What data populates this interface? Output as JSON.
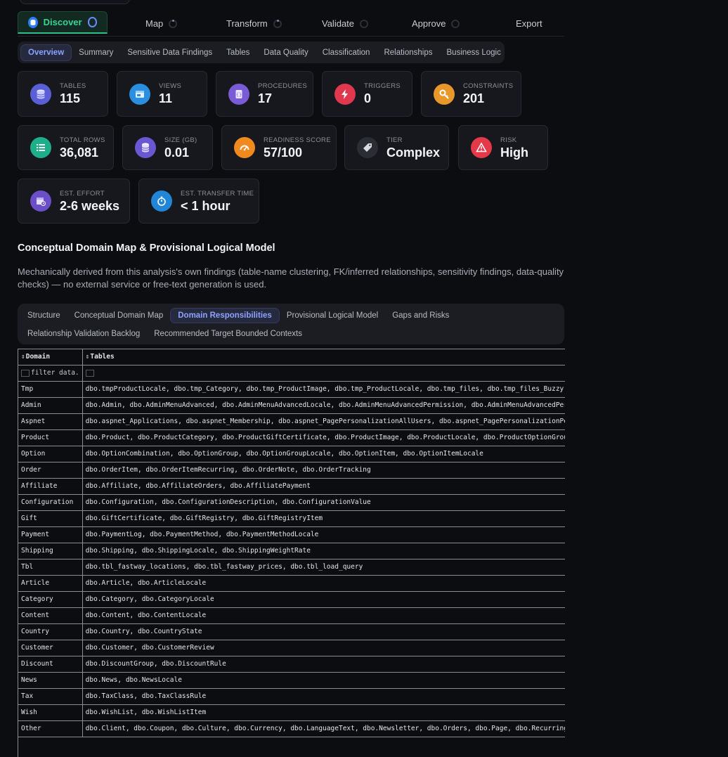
{
  "stepper": [
    {
      "label": "Discover",
      "active": true
    },
    {
      "label": "Map"
    },
    {
      "label": "Transform"
    },
    {
      "label": "Validate"
    },
    {
      "label": "Approve"
    },
    {
      "label": "Export"
    }
  ],
  "subnav": [
    "Overview",
    "Summary",
    "Sensitive Data Findings",
    "Tables",
    "Data Quality",
    "Classification",
    "Relationships",
    "Business Logic"
  ],
  "metrics": {
    "tables": {
      "label": "Tables",
      "value": "115"
    },
    "views": {
      "label": "Views",
      "value": "11"
    },
    "procedures": {
      "label": "Procedures",
      "value": "17"
    },
    "triggers": {
      "label": "Triggers",
      "value": "0"
    },
    "constraints": {
      "label": "Constraints",
      "value": "201"
    },
    "total_rows": {
      "label": "Total Rows",
      "value": "36,081"
    },
    "size": {
      "label": "Size (GB)",
      "value": "0.01"
    },
    "readiness": {
      "label": "Readiness Score",
      "value": "57/100"
    },
    "tier": {
      "label": "Tier",
      "value": "Complex"
    },
    "risk": {
      "label": "Risk",
      "value": "High"
    },
    "effort": {
      "label": "Est. Effort",
      "value": "2-6 weeks"
    },
    "transfer": {
      "label": "Est. Transfer Time",
      "value": "< 1 hour"
    }
  },
  "section": {
    "title": "Conceptual Domain Map & Provisional Logical Model",
    "description": "Mechanically derived from this analysis's own findings (table-name clustering, FK/inferred relationships, sensitivity findings, data-quality checks) — no external service or free-text generation is used."
  },
  "innertabs": {
    "row1": [
      "Structure",
      "Conceptual Domain Map",
      "Domain Responsibilities",
      "Provisional Logical Model",
      "Gaps and Risks"
    ],
    "row2": [
      "Relationship Validation Backlog",
      "Recommended Target Bounded Contexts"
    ],
    "active": "Domain Responsibilities"
  },
  "table": {
    "headers": [
      "Domain",
      "Tables"
    ],
    "sort_glyph": "⇕",
    "filter_text": "filter data.",
    "rows": [
      [
        "Tmp",
        "dbo.tmpProductLocale, dbo.tmp_Category, dbo.tmp_ProductImage, dbo.tmp_ProductLocale, dbo.tmp_files, dbo.tmp_files_Buzzy,"
      ],
      [
        "Admin",
        "dbo.Admin, dbo.AdminMenuAdvanced, dbo.AdminMenuAdvancedLocale, dbo.AdminMenuAdvancedPermission, dbo.AdminMenuAdvancedPerm"
      ],
      [
        "Aspnet",
        "dbo.aspnet_Applications, dbo.aspnet_Membership, dbo.aspnet_PagePersonalizationAllUsers, dbo.aspnet_PagePersonalizationPer"
      ],
      [
        "Product",
        "dbo.Product, dbo.ProductCategory, dbo.ProductGiftCertificate, dbo.ProductImage, dbo.ProductLocale, dbo.ProductOptionGroup"
      ],
      [
        "Option",
        "dbo.OptionCombination, dbo.OptionGroup, dbo.OptionGroupLocale, dbo.OptionItem, dbo.OptionItemLocale"
      ],
      [
        "Order",
        "dbo.OrderItem, dbo.OrderItemRecurring, dbo.OrderNote, dbo.OrderTracking"
      ],
      [
        "Affiliate",
        "dbo.Affiliate, dbo.AffiliateOrders, dbo.AffiliatePayment"
      ],
      [
        "Configuration",
        "dbo.Configuration, dbo.ConfigurationDescription, dbo.ConfigurationValue"
      ],
      [
        "Gift",
        "dbo.GiftCertificate, dbo.GiftRegistry, dbo.GiftRegistryItem"
      ],
      [
        "Payment",
        "dbo.PaymentLog, dbo.PaymentMethod, dbo.PaymentMethodLocale"
      ],
      [
        "Shipping",
        "dbo.Shipping, dbo.ShippingLocale, dbo.ShippingWeightRate"
      ],
      [
        "Tbl",
        "dbo.tbl_fastway_locations, dbo.tbl_fastway_prices, dbo.tbl_load_query"
      ],
      [
        "Article",
        "dbo.Article, dbo.ArticleLocale"
      ],
      [
        "Category",
        "dbo.Category, dbo.CategoryLocale"
      ],
      [
        "Content",
        "dbo.Content, dbo.ContentLocale"
      ],
      [
        "Country",
        "dbo.Country, dbo.CountryState"
      ],
      [
        "Customer",
        "dbo.Customer, dbo.CustomerReview"
      ],
      [
        "Discount",
        "dbo.DiscountGroup, dbo.DiscountRule"
      ],
      [
        "News",
        "dbo.News, dbo.NewsLocale"
      ],
      [
        "Tax",
        "dbo.TaxClass, dbo.TaxClassRule"
      ],
      [
        "Wish",
        "dbo.WishList, dbo.WishListItem"
      ],
      [
        "Other",
        "dbo.Client, dbo.Coupon, dbo.Culture, dbo.Currency, dbo.LanguageText, dbo.Newsletter, dbo.Orders, dbo.Page, dbo.Recurring"
      ]
    ]
  },
  "colors": {
    "accent_green": "#38d595",
    "accent_indigo": "#8ea2ff",
    "bg": "#0c0d10",
    "card": "#17181d"
  }
}
